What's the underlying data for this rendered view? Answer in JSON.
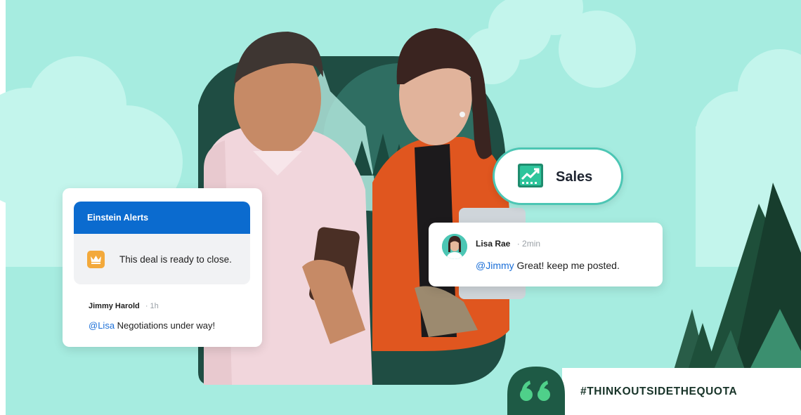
{
  "einstein_card": {
    "title": "Einstein Alerts",
    "alert_text": "This deal is ready to close.",
    "comment": {
      "author": "Jimmy Harold",
      "separator": "·",
      "time": "1h",
      "mention": "@Lisa",
      "text": " Negotiations under way!"
    }
  },
  "sales_badge": {
    "label": "Sales"
  },
  "lisa_card": {
    "author": "Lisa Rae",
    "separator": "·",
    "time": "2min",
    "mention": "@Jimmy",
    "text": " Great! keep me posted."
  },
  "hashtag": "#THINKOUTSIDETHEQUOTA",
  "colors": {
    "background": "#a6ece0",
    "einstein_header": "#0b6bcf",
    "mention_blue": "#1b6fd8",
    "teal_accent": "#4cc6b4",
    "forest_green": "#1e4f3a",
    "crown_orange": "#f3a93b"
  },
  "icons": [
    "crown-icon",
    "trend-chart-icon",
    "quote-icon"
  ]
}
